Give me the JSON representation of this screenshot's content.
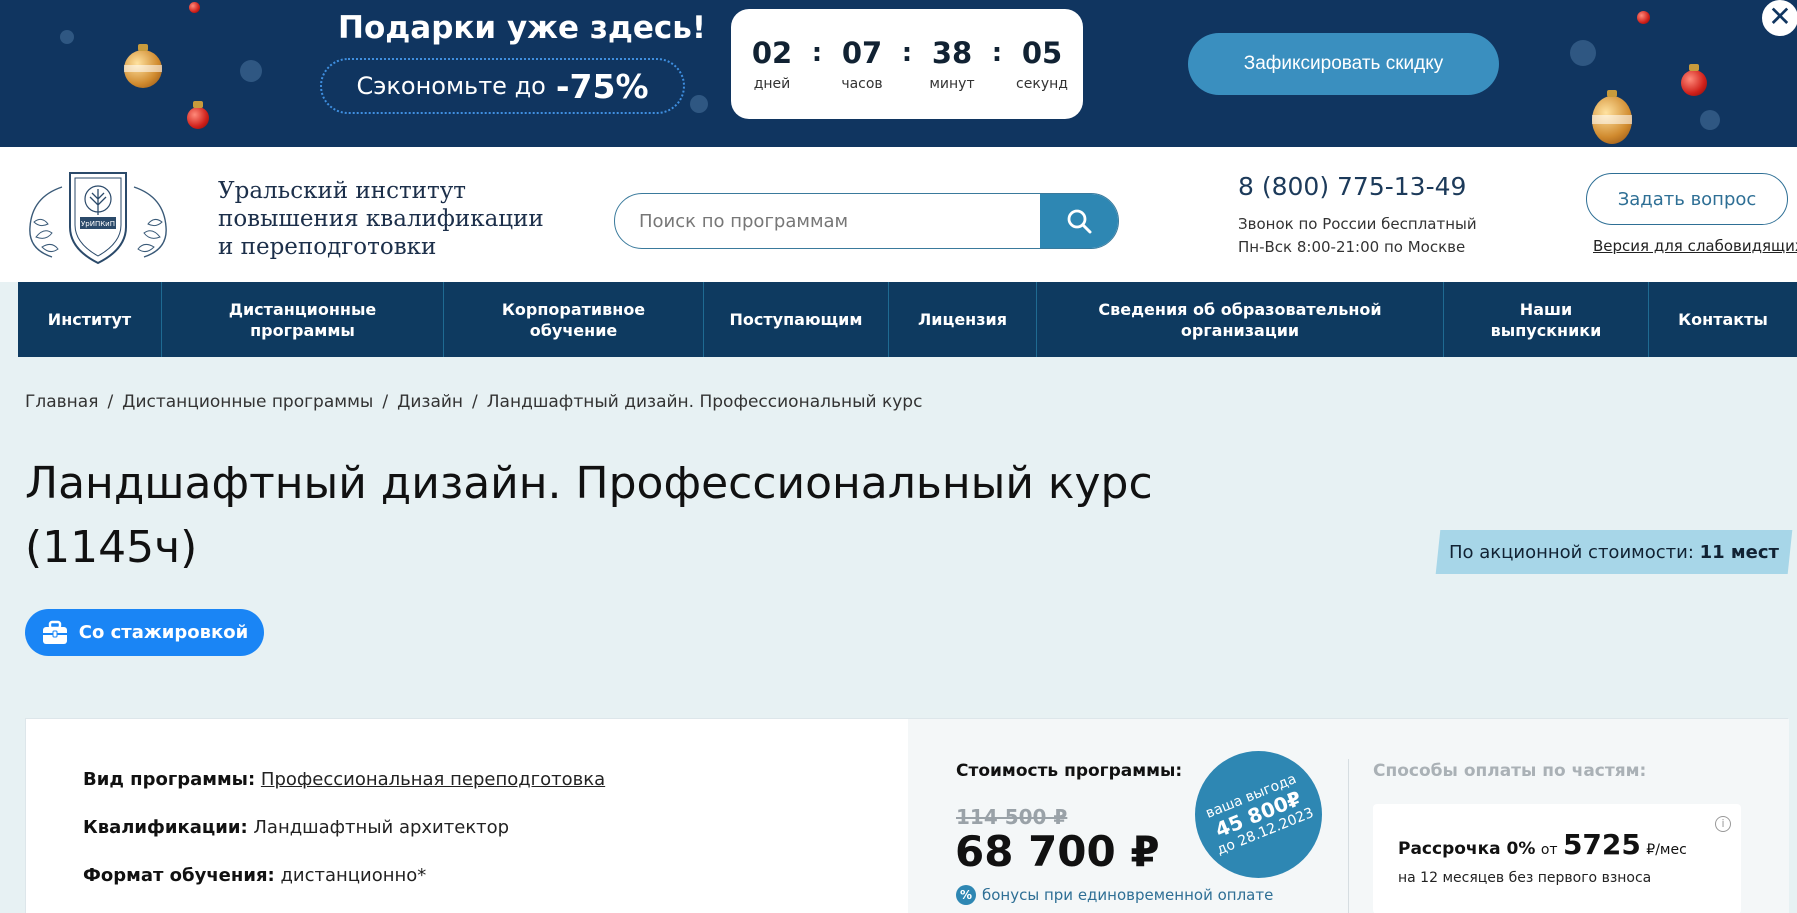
{
  "promo": {
    "title": "Подарки уже здесь!",
    "save_prefix": "Сэкономьте до",
    "save_value": "-75%",
    "timer": [
      {
        "value": "02",
        "label": "дней"
      },
      {
        "value": "07",
        "label": "часов"
      },
      {
        "value": "38",
        "label": "минут"
      },
      {
        "value": "05",
        "label": "секунд"
      }
    ],
    "timer_separator": ":",
    "cta": "Зафиксировать скидку",
    "close_glyph": "✕"
  },
  "header": {
    "logo_lines": [
      "Уральский институт",
      "повышения квалификации",
      "и переподготовки"
    ],
    "logo_emblem_text": "УрИПКиП",
    "search_placeholder": "Поиск по программам",
    "phone": "8 (800) 775-13-49",
    "phone_note_1": "Звонок по России бесплатный",
    "phone_note_2": "Пн-Вск 8:00-21:00 по Москве",
    "ask_button": "Задать вопрос",
    "vision_link": "Версия для слабовидящих"
  },
  "nav": {
    "items": [
      {
        "lines": [
          "Институт"
        ]
      },
      {
        "lines": [
          "Дистанционные",
          "программы"
        ]
      },
      {
        "lines": [
          "Корпоративное",
          "обучение"
        ]
      },
      {
        "lines": [
          "Поступающим"
        ]
      },
      {
        "lines": [
          "Лицензия"
        ]
      },
      {
        "lines": [
          "Сведения об образовательной",
          "организации"
        ]
      },
      {
        "lines": [
          "Наши",
          "выпускники"
        ]
      },
      {
        "lines": [
          "Контакты"
        ]
      }
    ]
  },
  "breadcrumb": {
    "items": [
      "Главная",
      "Дистанционные программы",
      "Дизайн",
      "Ландшафтный дизайн. Профессиональный курс"
    ],
    "separator": "/"
  },
  "page": {
    "title_line1": "Ландшафтный дизайн. Профессиональный курс",
    "title_line2": "(1145ч)",
    "promo_tag_label": "По акционной стоимости:",
    "promo_tag_value": "11 мест",
    "internship_button": "Со стажировкой"
  },
  "details": {
    "program_type_label": "Вид программы:",
    "program_type_value": "Профессиональная переподготовка",
    "qualification_label": "Квалификации:",
    "qualification_value": "Ландшафтный архитектор",
    "format_label": "Формат обучения:",
    "format_value": "дистанционно*"
  },
  "pricing": {
    "label": "Стоимость программы:",
    "old_price": "114 500 ₽",
    "new_price": "68 700 ₽",
    "bonus_icon_glyph": "%",
    "bonus_text": "бонусы при единовременной оплате",
    "badge_line1": "ваша выгода",
    "badge_line2": "45 800₽",
    "badge_line3": "до 28.12.2023",
    "parts_label": "Способы оплаты по частям:",
    "installment_label": "Рассрочка 0%",
    "installment_from": "от",
    "installment_amount": "5725",
    "installment_unit": "₽/мес",
    "installment_note": "на 12 месяцев без первого взноса",
    "info_glyph": "i"
  },
  "colors": {
    "banner_bg": "#103560",
    "nav_bg": "#0e3a60",
    "accent": "#2e87b3",
    "internship_bg": "#1a85f5",
    "page_bg": "#e7f1f3"
  }
}
